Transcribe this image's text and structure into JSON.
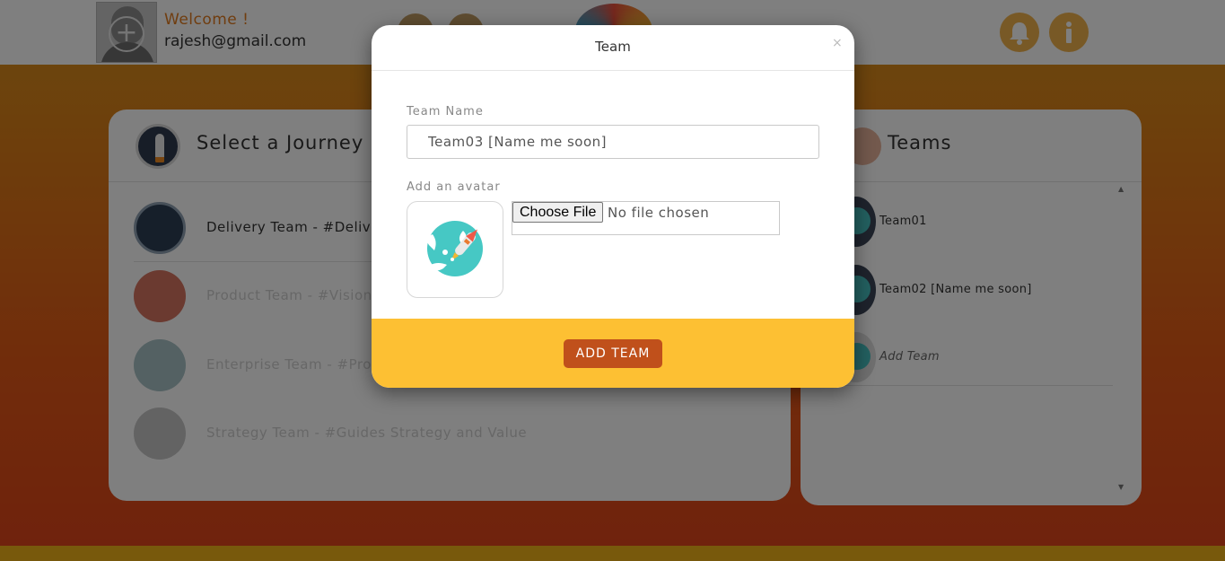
{
  "header": {
    "welcome": "Welcome !",
    "email": "rajesh@gmail.com"
  },
  "journey_panel": {
    "title": "Select a Journey",
    "items": [
      {
        "label": "Delivery Team - #Deliver"
      },
      {
        "label": "Product Team - #Vision"
      },
      {
        "label": "Enterprise Team - #Prote"
      },
      {
        "label": "Strategy Team - #Guides Strategy and Value"
      }
    ]
  },
  "teams_panel": {
    "title": "Teams",
    "items": [
      {
        "label": "Team01"
      },
      {
        "label": "Team02 [Name me soon]"
      },
      {
        "label": "Add Team"
      }
    ]
  },
  "modal": {
    "title": "Team",
    "close_glyph": "×",
    "team_name_label": "Team Name",
    "team_name_value": "Team03 [Name me soon]",
    "avatar_label": "Add an avatar",
    "file_button": "Choose File",
    "file_status": "No file chosen",
    "submit_label": "ADD TEAM"
  },
  "colors": {
    "accent": "#fdc033",
    "button": "#c0501b",
    "welcome_text": "#e07a1f"
  }
}
